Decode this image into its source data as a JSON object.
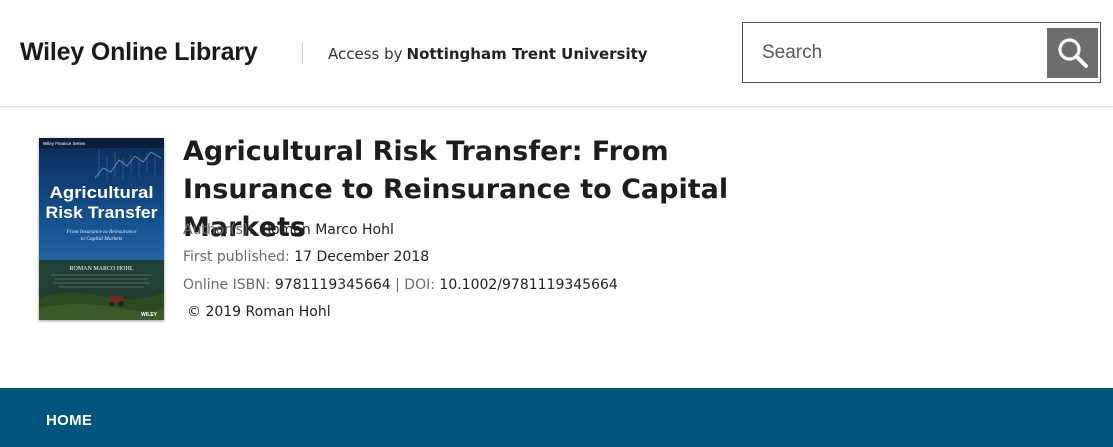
{
  "header": {
    "logo": "Wiley Online Library",
    "access_label": "Access by",
    "institution": "Nottingham Trent University"
  },
  "search": {
    "placeholder": "Search",
    "button_icon": "search-icon"
  },
  "book": {
    "cover": {
      "series": "Wiley Finance Series",
      "title_line1": "Agricultural",
      "title_line2": "Risk Transfer",
      "subtitle_line1": "From Insurance to Reinsurance",
      "subtitle_line2": "to Capital Markets",
      "author": "ROMAN MARCO HOHL",
      "publisher": "WILEY"
    },
    "title": "Agricultural Risk Transfer: From Insurance to Reinsurance to Capital Markets",
    "authors_label": "Author(s):",
    "authors": "Roman Marco Hohl",
    "published_label": "First published:",
    "published": "17 December 2018",
    "isbn_label": "Online ISBN:",
    "isbn": "9781119345664",
    "separator": "|",
    "doi_label": "DOI:",
    "doi": "10.1002/9781119345664",
    "copyright": "© 2019 Roman Hohl"
  },
  "footer": {
    "home_label": "HOME"
  },
  "colors": {
    "footer_bg": "#00557a",
    "search_button": "#6d6d6d"
  }
}
